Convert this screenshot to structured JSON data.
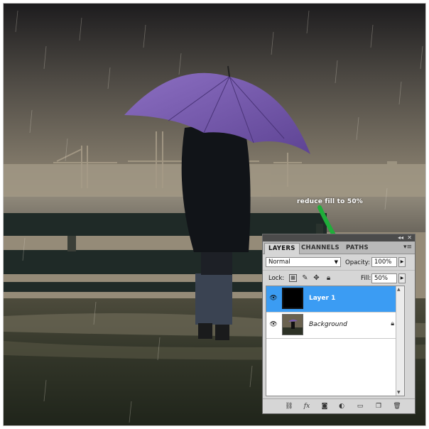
{
  "annotation": {
    "text": "reduce fill to 50%",
    "arrow_color": "#1fae3a"
  },
  "photo": {
    "icon": "rainy-umbrella-photo"
  },
  "layers_panel": {
    "collapse_glyph": "◂◂",
    "close_glyph": "✕",
    "tabs": [
      {
        "label": "LAYERS",
        "active": true
      },
      {
        "label": "CHANNELS",
        "active": false
      },
      {
        "label": "PATHS",
        "active": false
      }
    ],
    "menu_glyph": "▾≡",
    "blend_mode": "Normal",
    "opacity_label": "Opacity:",
    "opacity_value": "100%",
    "lock_label": "Lock:",
    "fill_label": "Fill:",
    "fill_value": "50%",
    "layers": [
      {
        "name": "Layer 1",
        "selected": true,
        "visible": true,
        "locked": false
      },
      {
        "name": "Background",
        "selected": false,
        "visible": true,
        "locked": true
      }
    ],
    "bottom_icons": [
      "link-icon",
      "fx-icon",
      "mask-icon",
      "adjustment-icon",
      "group-icon",
      "new-layer-icon",
      "trash-icon"
    ],
    "accent_color": "#3b9cf3"
  }
}
